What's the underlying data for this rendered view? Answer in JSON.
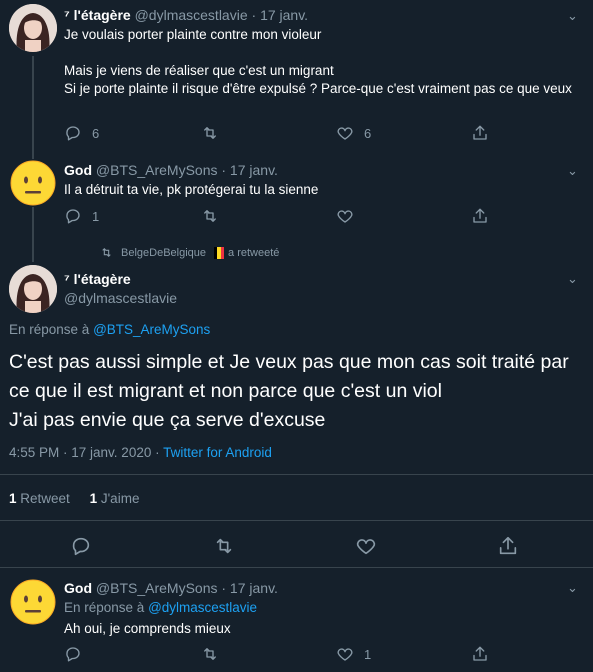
{
  "tweet1": {
    "name": "⁷ l'étagère",
    "handle": "@dylmascestlavie",
    "time": "· 17 janv.",
    "text": "Je voulais porter plainte contre mon violeur\n\nMais je viens de réaliser que c'est un migrant\nSi je porte plainte il risque d'être expulsé ? Parce-que c'est vraiment pas ce que veux",
    "replies": "6",
    "likes": "6"
  },
  "tweet2": {
    "name": "God",
    "handle": "@BTS_AreMySons",
    "time": "· 17 janv.",
    "text": "Il a détruit ta vie, pk protégerai tu la sienne",
    "replies": "1"
  },
  "retweet_notice": {
    "user": "BelgeDeBelgique",
    "suffix": "a retweeté"
  },
  "main_tweet": {
    "name": "⁷ l'étagère",
    "handle": "@dylmascestlavie",
    "reply_prefix": "En réponse à ",
    "reply_to": "@BTS_AreMySons",
    "text": "C'est pas aussi simple et Je veux pas que mon cas soit traité par ce que il est migrant et non parce que c'est un viol\nJ'ai pas envie que ça serve d'excuse",
    "timestamp": "4:55 PM · 17 janv. 2020 · ",
    "source": "Twitter for Android",
    "retweet_count": "1",
    "retweet_label": "Retweet",
    "like_count": "1",
    "like_label": "J'aime"
  },
  "tweet4": {
    "name": "God",
    "handle": "@BTS_AreMySons",
    "time": "· 17 janv.",
    "reply_prefix": "En réponse à ",
    "reply_to": "@dylmascestlavie",
    "text": "Ah oui, je comprends mieux",
    "likes": "1"
  },
  "colors": {
    "background": "#15202b",
    "muted": "#8899a6",
    "link": "#1da1f2",
    "divider": "#38444d"
  }
}
